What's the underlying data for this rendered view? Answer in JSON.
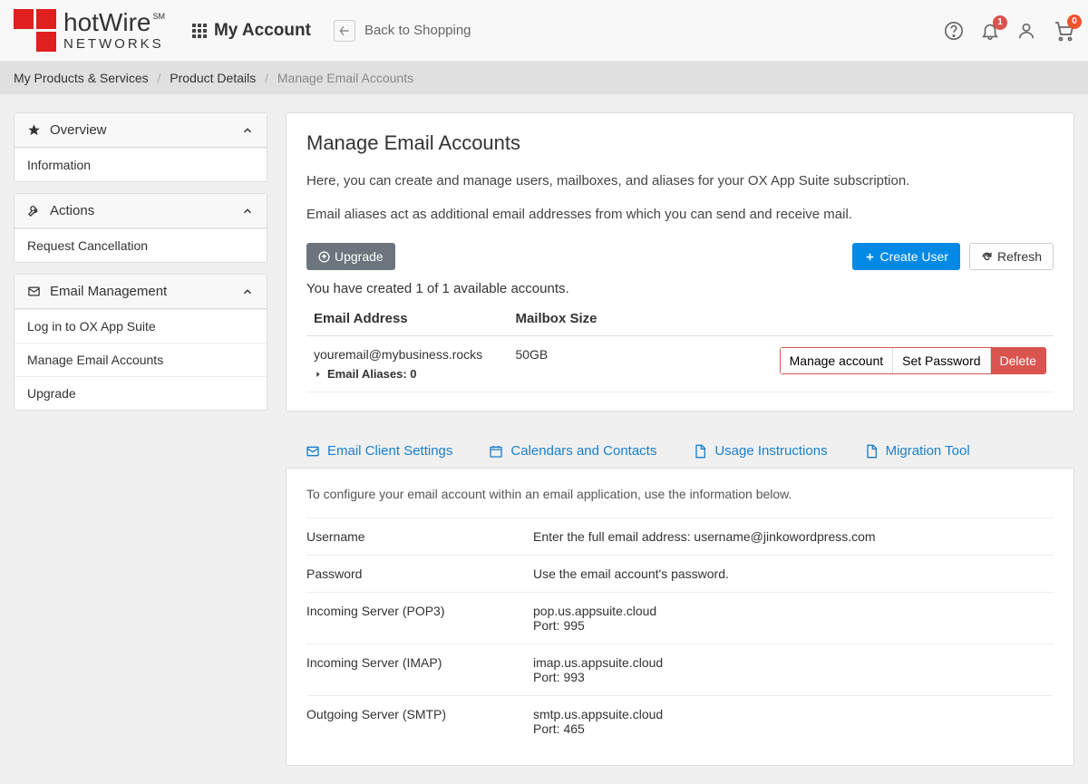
{
  "header": {
    "brand": "hotWire",
    "brand_sub": "NETWORKS",
    "my_account": "My Account",
    "back_to_shopping": "Back to Shopping",
    "notifications_count": "1",
    "cart_count": "0"
  },
  "breadcrumb": {
    "item1": "My Products & Services",
    "item2": "Product Details",
    "item3": "Manage Email Accounts"
  },
  "sidebar": {
    "overview": {
      "title": "Overview",
      "items": [
        "Information"
      ]
    },
    "actions": {
      "title": "Actions",
      "items": [
        "Request Cancellation"
      ]
    },
    "email": {
      "title": "Email Management",
      "items": [
        "Log in to OX App Suite",
        "Manage Email Accounts",
        "Upgrade"
      ]
    }
  },
  "main": {
    "title": "Manage Email Accounts",
    "desc1": "Here, you can create and manage users, mailboxes, and aliases for your OX App Suite subscription.",
    "desc2": "Email aliases act as additional email addresses from which you can send and receive mail.",
    "upgrade_btn": "Upgrade",
    "create_user_btn": "Create User",
    "refresh_btn": "Refresh",
    "count_text": "You have created 1 of 1 available accounts.",
    "table_headers": {
      "email": "Email Address",
      "size": "Mailbox Size"
    },
    "rows": [
      {
        "email": "youremail@mybusiness.rocks",
        "aliases": "Email Aliases: 0",
        "size": "50GB",
        "manage": "Manage account",
        "setpw": "Set Password",
        "delete": "Delete"
      }
    ]
  },
  "tabs": {
    "t1": "Email Client Settings",
    "t2": "Calendars and Contacts",
    "t3": "Usage Instructions",
    "t4": "Migration Tool"
  },
  "settings": {
    "intro": "To configure your email account within an email application, use the information below.",
    "rows": [
      {
        "k": "Username",
        "v": "Enter the full email address: username@jinkowordpress.com"
      },
      {
        "k": "Password",
        "v": "Use the email account's password."
      },
      {
        "k": "Incoming Server (POP3)",
        "v": "pop.us.appsuite.cloud",
        "port": "Port: 995"
      },
      {
        "k": "Incoming Server (IMAP)",
        "v": "imap.us.appsuite.cloud",
        "port": "Port: 993"
      },
      {
        "k": "Outgoing Server (SMTP)",
        "v": "smtp.us.appsuite.cloud",
        "port": "Port: 465"
      }
    ]
  }
}
